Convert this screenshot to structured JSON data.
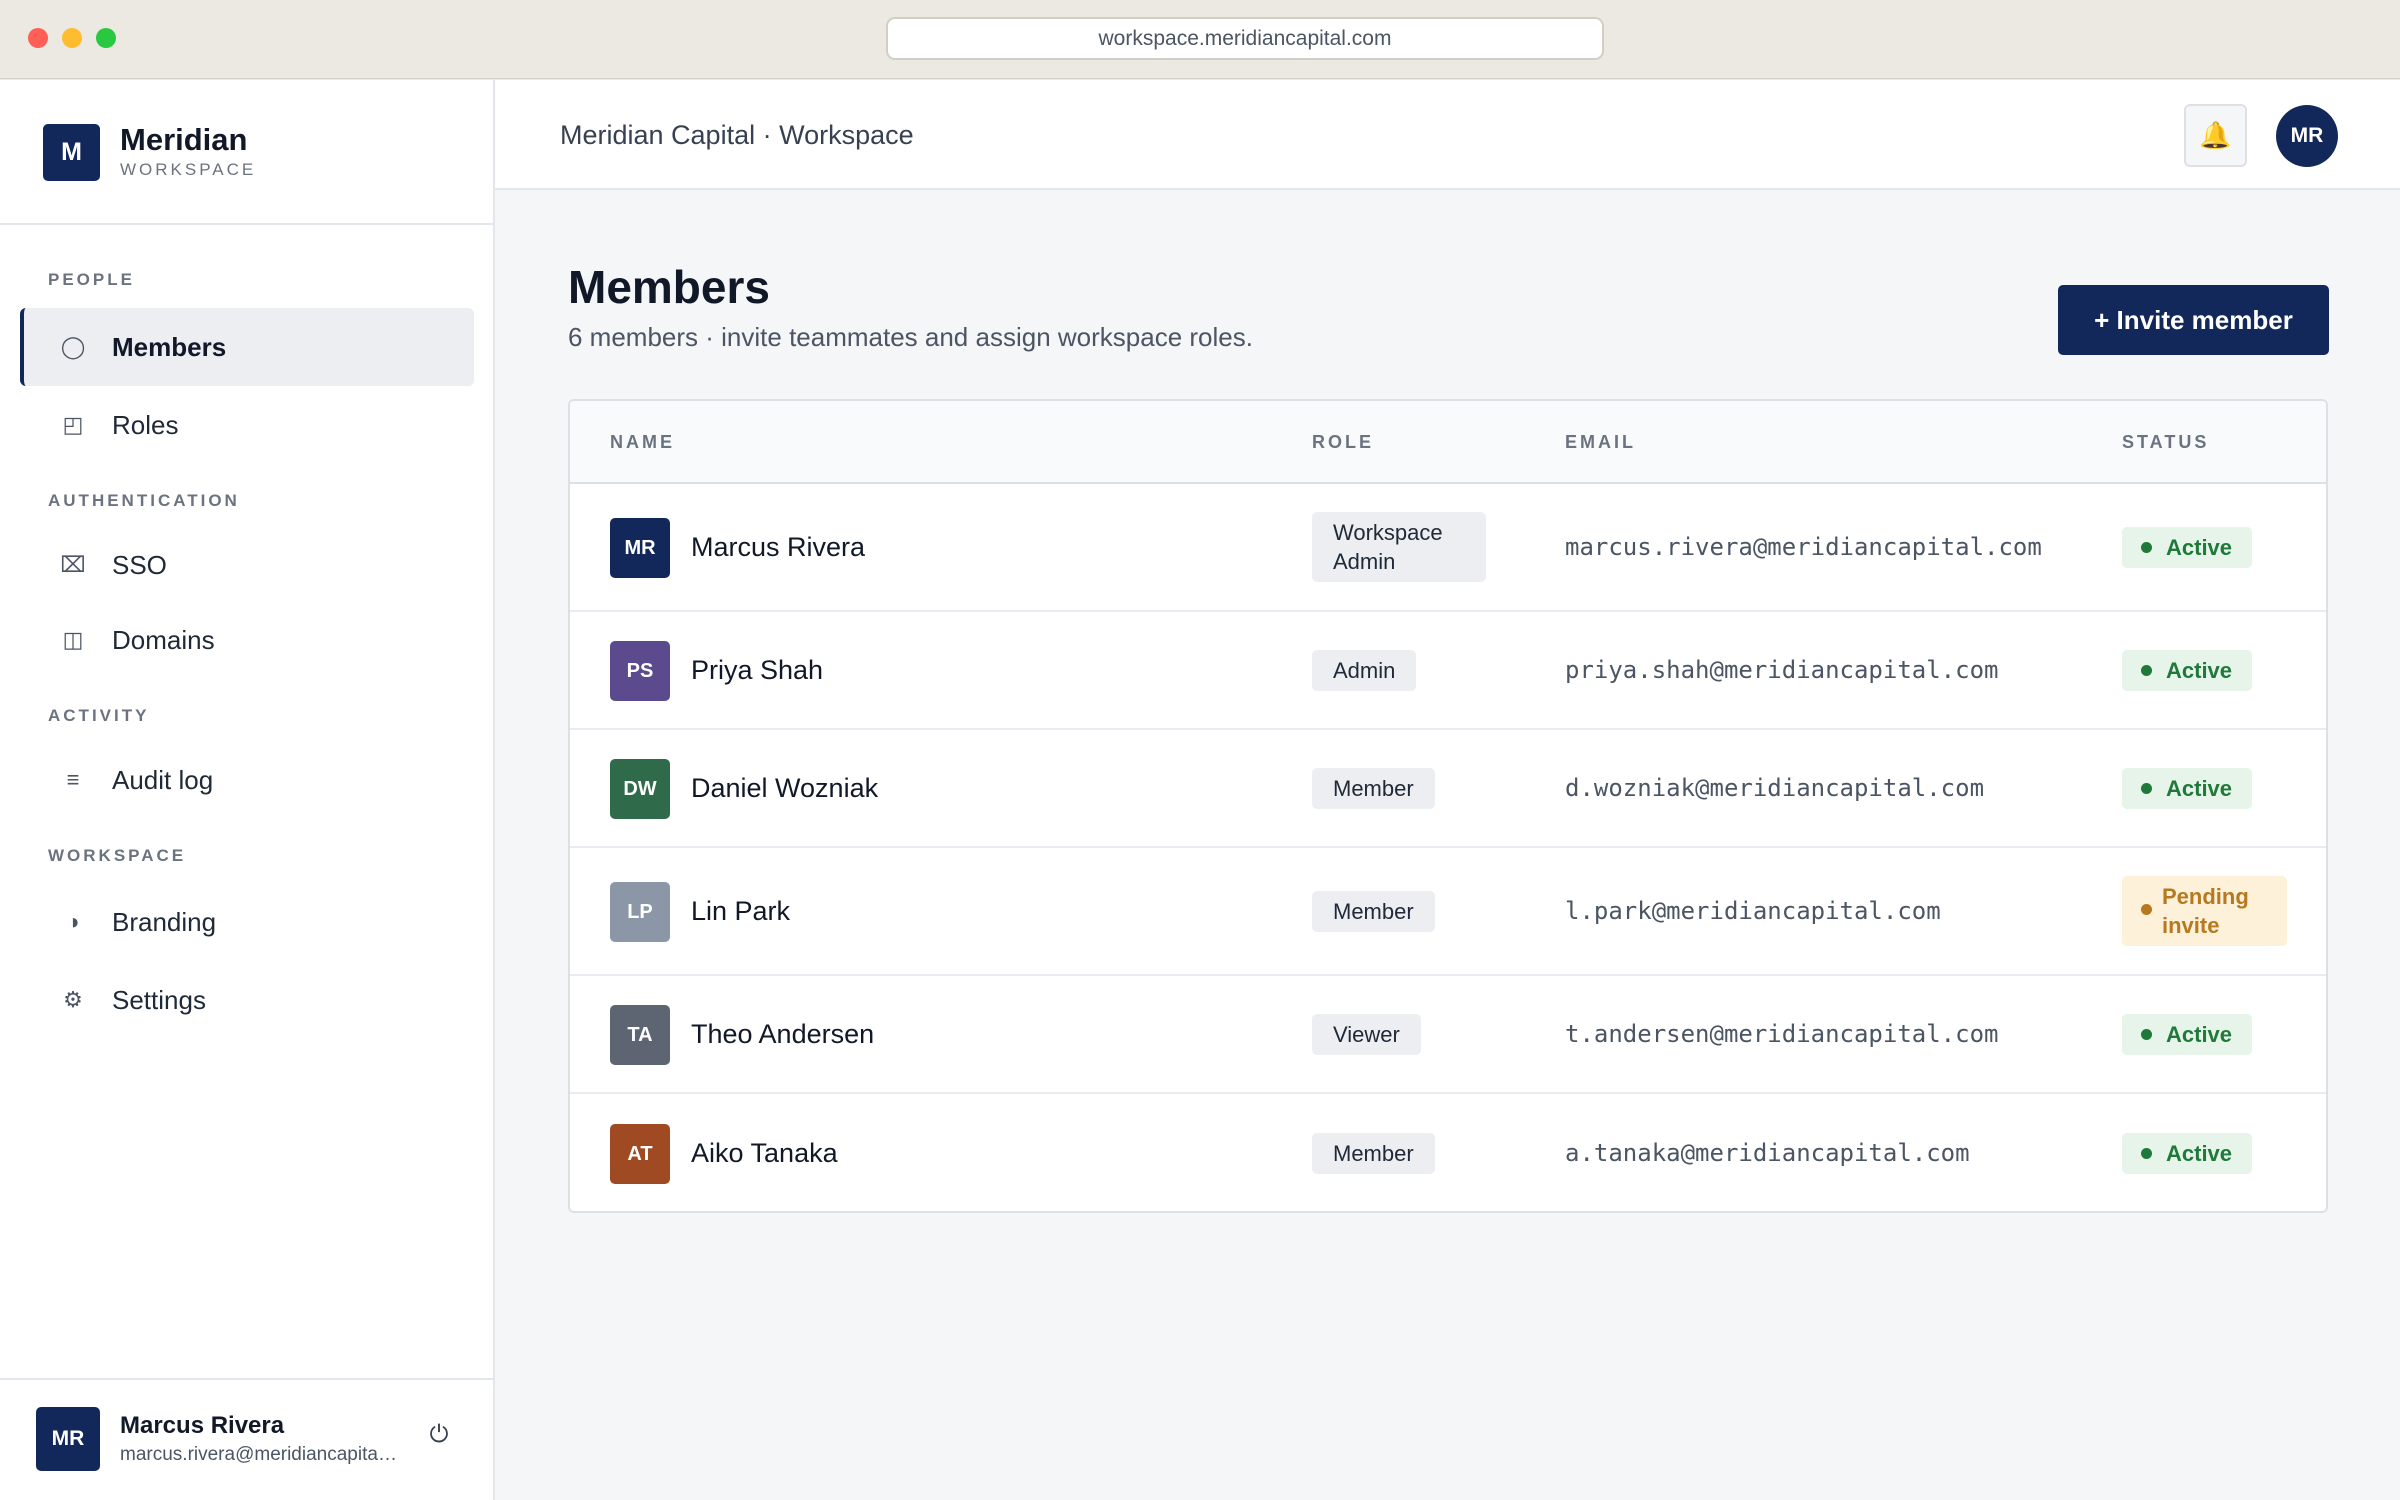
{
  "browser": {
    "url": "workspace.meridiancapital.com"
  },
  "brand": {
    "logo": "M",
    "name": "Meridian",
    "sub": "WORKSPACE"
  },
  "sidebar": {
    "sections": [
      {
        "label": "PEOPLE"
      },
      {
        "label": "AUTHENTICATION"
      },
      {
        "label": "ACTIVITY"
      },
      {
        "label": "WORKSPACE"
      }
    ],
    "items": [
      {
        "label": "Members",
        "icon": "circle-icon",
        "glyph": "◯",
        "active": true
      },
      {
        "label": "Roles",
        "icon": "roles-icon",
        "glyph": "◰"
      },
      {
        "label": "SSO",
        "icon": "sso-icon",
        "glyph": "⌧"
      },
      {
        "label": "Domains",
        "icon": "domains-icon",
        "glyph": "◫"
      },
      {
        "label": "Audit log",
        "icon": "list-icon",
        "glyph": "≡"
      },
      {
        "label": "Branding",
        "icon": "contrast-icon",
        "glyph": "◑"
      },
      {
        "label": "Settings",
        "icon": "gear-icon",
        "glyph": "⚙"
      }
    ],
    "user": {
      "initials": "MR",
      "name": "Marcus Rivera",
      "email": "marcus.rivera@meridiancapital.com"
    },
    "power_glyph": "⏻"
  },
  "topbar": {
    "breadcrumb": "Meridian Capital · Workspace",
    "bell_glyph": "🔔",
    "avatar": "MR"
  },
  "page": {
    "title": "Members",
    "subtitle": "6 members · invite teammates and assign workspace roles.",
    "invite_label": "+ Invite member"
  },
  "table": {
    "headers": [
      "NAME",
      "ROLE",
      "EMAIL",
      "STATUS"
    ],
    "rows": [
      {
        "initials": "MR",
        "color": "#13285a",
        "name": "Marcus Rivera",
        "role": "Workspace Admin",
        "email": "marcus.rivera@meridiancapital.com",
        "status": "Active",
        "status_type": "active"
      },
      {
        "initials": "PS",
        "color": "#5b4a8e",
        "name": "Priya Shah",
        "role": "Admin",
        "email": "priya.shah@meridiancapital.com",
        "status": "Active",
        "status_type": "active"
      },
      {
        "initials": "DW",
        "color": "#2f6b4a",
        "name": "Daniel Wozniak",
        "role": "Member",
        "email": "d.wozniak@meridiancapital.com",
        "status": "Active",
        "status_type": "active"
      },
      {
        "initials": "LP",
        "color": "#8b97a6",
        "name": "Lin Park",
        "role": "Member",
        "email": "l.park@meridiancapital.com",
        "status": "Pending invite",
        "status_type": "pending"
      },
      {
        "initials": "TA",
        "color": "#5d6472",
        "name": "Theo Andersen",
        "role": "Viewer",
        "email": "t.andersen@meridiancapital.com",
        "status": "Active",
        "status_type": "active"
      },
      {
        "initials": "AT",
        "color": "#a04a24",
        "name": "Aiko Tanaka",
        "role": "Member",
        "email": "a.tanaka@meridiancapital.com",
        "status": "Active",
        "status_type": "active"
      }
    ]
  }
}
